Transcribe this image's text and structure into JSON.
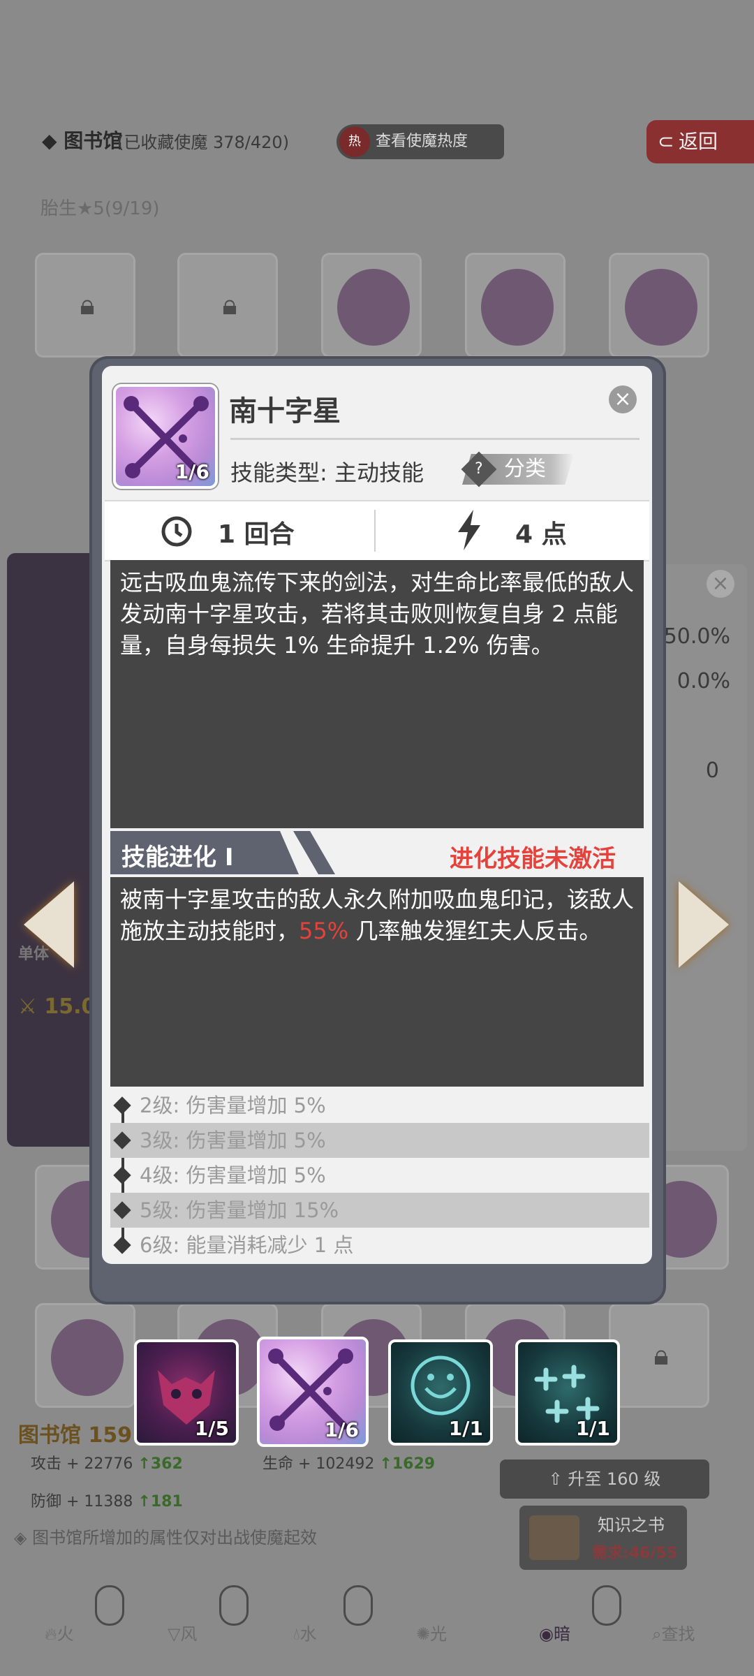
{
  "background": {
    "header": {
      "title": "图书馆",
      "collection": "(已收藏使魔 378/420)",
      "hot_icon": "热",
      "hot_button": "查看使魔热度",
      "back_icon": "back-arrow-icon",
      "back_button": "返回"
    },
    "section_title": "胎生★5(9/19)",
    "right_panel_values": [
      "50.0%",
      "0.0%",
      "0"
    ],
    "left_panel_text": "单体",
    "left_panel_value": "15.0",
    "stats": {
      "title": "图书馆 159",
      "attack_label": "攻击 + 22776",
      "attack_up": "↑362",
      "life_label": "生命 + 102492",
      "life_up": "↑1629",
      "defense_label": "防御 + 11388",
      "defense_up": "↑181"
    },
    "upgrade_button": "升至 160 级",
    "book": {
      "title": "知识之书",
      "requirement": "需求:46/55"
    },
    "note": "图书馆所增加的属性仅对出战使魔起效",
    "tabs": [
      "火",
      "风",
      "水",
      "光",
      "暗",
      "查找"
    ],
    "active_tab": "暗"
  },
  "modal": {
    "skill_name": "南十字星",
    "skill_level": "1/6",
    "skill_type": "技能类型: 主动技能",
    "category_icon": "?",
    "category": "分类",
    "close_icon": "×",
    "cooldown": "1 回合",
    "energy": "4 点",
    "description": "远古吸血鬼流传下来的剑法，对生命比率最低的敌人发动南十字星攻击，若将其击败则恢复自身 2 点能量，自身每损失 1% 生命提升 1.2% 伤害。",
    "evolution": {
      "title": "技能进化 Ⅰ",
      "status": "进化技能未激活",
      "desc_part1": "被南十字星攻击的敌人永久附加吸血鬼印记，该敌人施放主动技能时，",
      "desc_highlight": "55%",
      "desc_part2": " 几率触发猩红夫人反击。"
    },
    "levels": [
      "2级: 伤害量增加 5%",
      "3级: 伤害量增加 5%",
      "4级: 伤害量增加 5%",
      "5级: 伤害量增加 15%",
      "6级: 能量消耗减少 1 点"
    ]
  },
  "skills_bar": [
    {
      "level": "1/5",
      "icon": "demon-mask-icon"
    },
    {
      "level": "1/6",
      "icon": "southern-cross-icon"
    },
    {
      "level": "1/1",
      "icon": "grin-face-icon"
    },
    {
      "level": "1/1",
      "icon": "plus-crosses-icon"
    }
  ],
  "colors": {
    "highlight": "#e5423c",
    "modal_frame": "#5f6370",
    "desc_bg": "#454545"
  }
}
